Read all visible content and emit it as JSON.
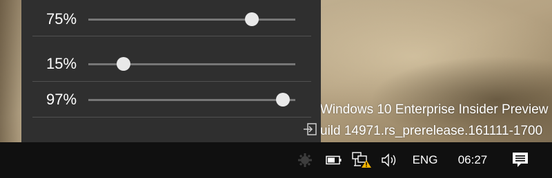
{
  "desktop": {
    "watermark_line1": "Windows 10 Enterprise Insider Preview",
    "watermark_line2": "uild 14971.rs_prerelease.161111-1700"
  },
  "sliders": [
    {
      "label": "75%",
      "value": 0.79
    },
    {
      "label": "15%",
      "value": 0.17
    },
    {
      "label": "97%",
      "value": 0.94
    }
  ],
  "taskbar": {
    "icons": [
      "brightness-icon",
      "battery-icon",
      "network-warning-icon",
      "volume-icon"
    ],
    "language": "ENG",
    "time": "06:27"
  },
  "colors": {
    "panel_bg": "#2f2f2f",
    "taskbar_bg": "#101010",
    "warning": "#f5b400"
  }
}
